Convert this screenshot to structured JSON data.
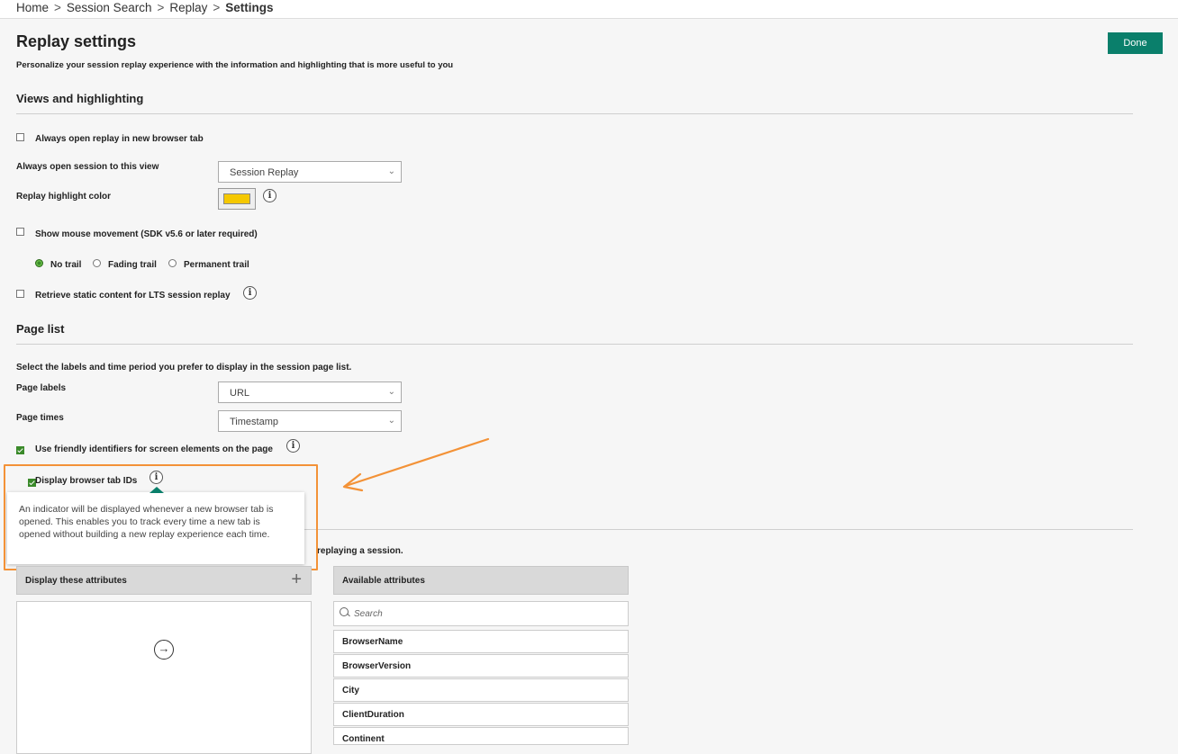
{
  "breadcrumb": {
    "items": [
      "Home",
      "Session Search",
      "Replay"
    ],
    "current": "Settings",
    "separator": ">"
  },
  "header": {
    "title": "Replay settings",
    "subtitle": "Personalize your session replay experience with the information and highlighting that is more useful to you",
    "done_label": "Done"
  },
  "views": {
    "section_title": "Views and highlighting",
    "open_new_tab_label": "Always open replay in new browser tab",
    "open_view_label": "Always open session to this view",
    "open_view_value": "Session Replay",
    "highlight_label": "Replay highlight color",
    "highlight_color": "#f5c800",
    "mouse_label": "Show mouse movement (SDK v5.6 or later required)",
    "trail_options": [
      "No trail",
      "Fading trail",
      "Permanent trail"
    ],
    "trail_selected": "No trail",
    "static_label": "Retrieve static content for LTS session replay"
  },
  "page_list": {
    "section_title": "Page list",
    "description": "Select the labels and time period you prefer to display in the session page list.",
    "labels_label": "Page labels",
    "labels_value": "URL",
    "times_label": "Page times",
    "times_value": "Timestamp",
    "friendly_label": "Use friendly identifiers for screen elements on the page",
    "tab_ids_label": "Display browser tab IDs"
  },
  "tooltip": {
    "text": "An indicator will be displayed whenever a new browser tab is opened. This enables you to track every time a new tab is opened without building a new replay experience each time."
  },
  "attributes": {
    "partial_text": "replaying a session.",
    "display_header": "Display these attributes",
    "add_icon": "+",
    "available_header": "Available attributes",
    "search_placeholder": "Search",
    "items": [
      "BrowserName",
      "BrowserVersion",
      "City",
      "ClientDuration",
      "Continent"
    ]
  },
  "icons": {
    "info": "i",
    "chevron": "⌄",
    "arrow_right": "→"
  },
  "colors": {
    "accent": "#0a7f6b",
    "annotation": "#f39237"
  }
}
